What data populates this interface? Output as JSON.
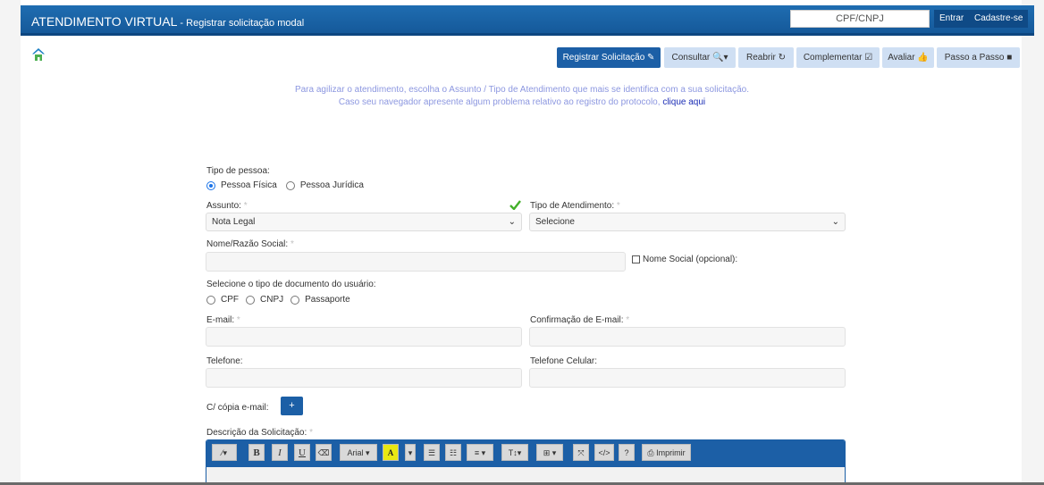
{
  "header": {
    "title": "ATENDIMENTO VIRTUAL",
    "subtitle": " - Registrar solicitação modal",
    "cpf_placeholder": "CPF/CNPJ",
    "login_label": "Entrar",
    "signup_label": "Cadastre-se"
  },
  "toolbar": {
    "registrar": "Registrar Solicitação ✎",
    "consultar": "Consultar 🔍▾",
    "reabrir": "Reabrir ↻",
    "complementar": "Complementar ☑",
    "avaliar": "Avaliar 👍",
    "passo": "Passo a Passo ■"
  },
  "info": {
    "line1": "Para agilizar o atendimento, escolha o Assunto / Tipo de Atendimento que mais se identifica com a sua solicitação.",
    "line2": "Caso seu navegador apresente algum problema relativo ao registro do protocolo,",
    "link": "clique aqui"
  },
  "form": {
    "tipo_pessoa_label": "Tipo de pessoa:",
    "pessoa_fisica": "Pessoa Física",
    "pessoa_juridica": "Pessoa Jurídica",
    "assunto_label": "Assunto:",
    "assunto_value": "Nota Legal",
    "tipo_atendimento_label": "Tipo de Atendimento:",
    "tipo_atendimento_value": "Selecione",
    "nome_label": "Nome/Razão Social:",
    "nome_social_label": "Nome Social (opcional):",
    "doc_label": "Selecione o tipo de documento do usuário:",
    "doc_cpf": "CPF",
    "doc_cnpj": "CNPJ",
    "doc_passaporte": "Passaporte",
    "email_label": "E-mail:",
    "email_confirm_label": "Confirmação de E-mail:",
    "telefone_label": "Telefone:",
    "celular_label": "Telefone Celular:",
    "copia_label": "C/ cópia e-mail:",
    "plus_label": "+",
    "descricao_label": "Descrição da Solicitação:",
    "required_mark": "*"
  },
  "editor": {
    "magic": "⁄▾",
    "bold": "B",
    "italic": "I",
    "underline": "U",
    "eraser": "⌫",
    "font": "Arial ▾",
    "color": "A",
    "color_drop": "▾",
    "ul": "☰",
    "ol": "☷",
    "align": "≡ ▾",
    "textsize": "T↕▾",
    "table": "⊞ ▾",
    "fullscreen": "⤧",
    "code": "</>",
    "help": "?",
    "print": "⎙ Imprimir"
  },
  "colors": {
    "header_blue": "#1f6db1",
    "primary_button": "#1c5fa6",
    "secondary_button": "#cfdff3",
    "info_text": "#8c97e0",
    "success_check": "#43b02a"
  }
}
